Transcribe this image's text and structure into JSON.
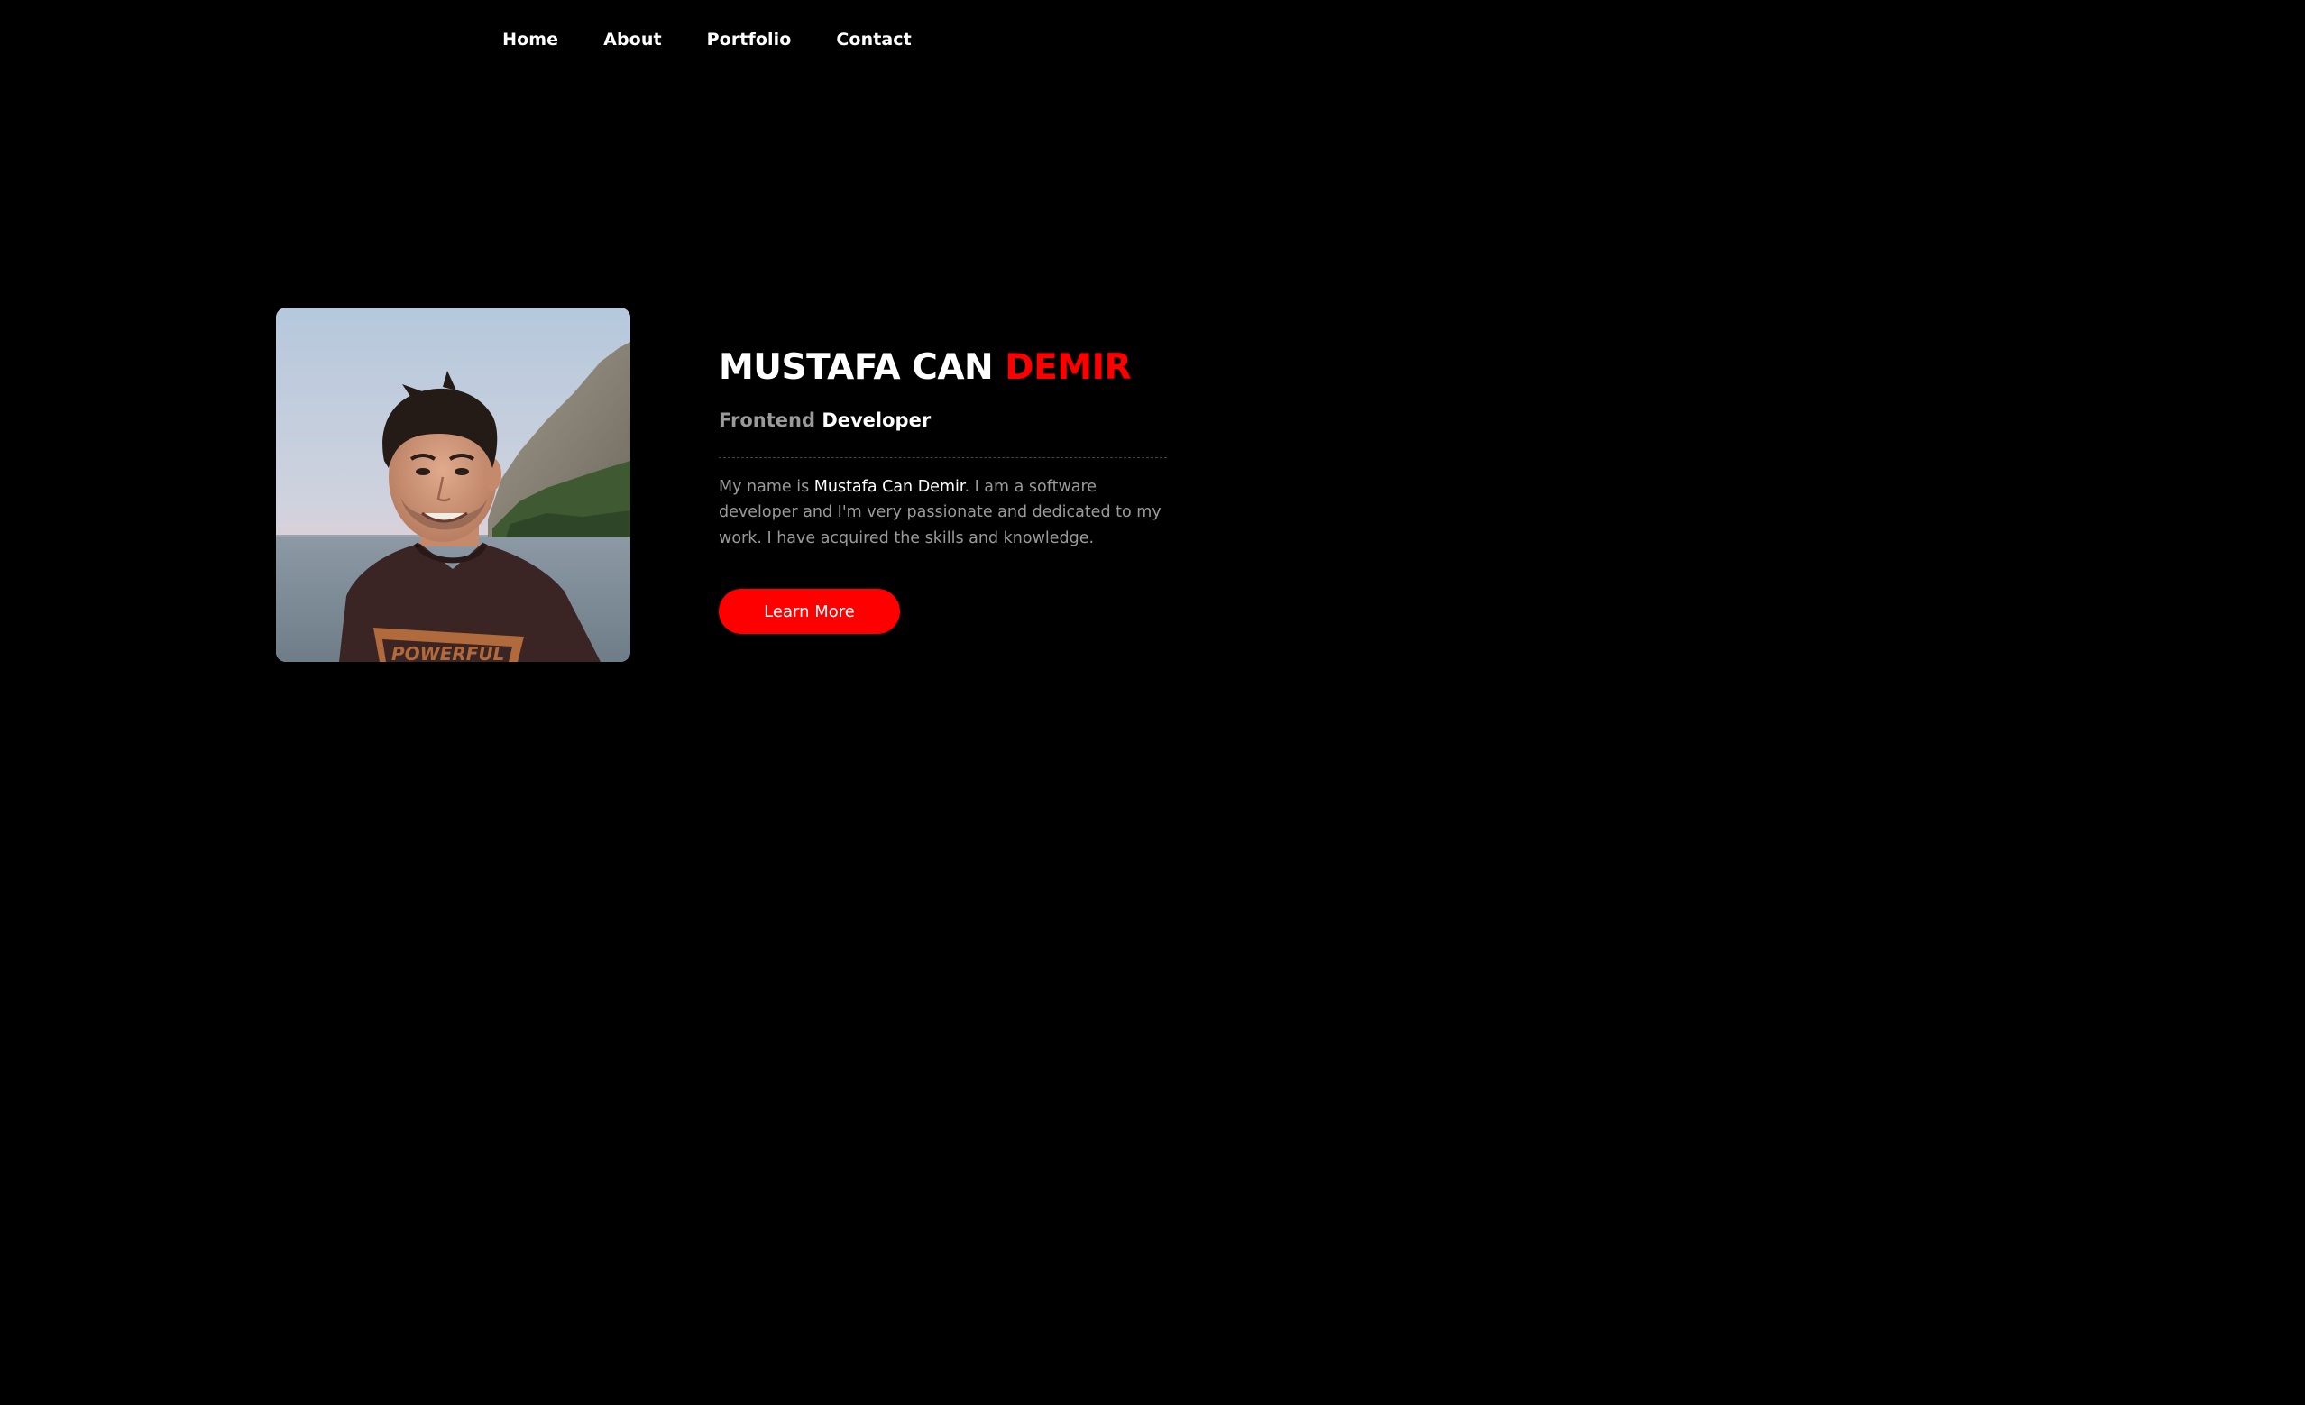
{
  "nav": {
    "items": [
      {
        "label": "Home"
      },
      {
        "label": "About"
      },
      {
        "label": "Portfolio"
      },
      {
        "label": "Contact"
      }
    ]
  },
  "hero": {
    "name_first": "MUSTAFA CAN",
    "name_last": "DEMIR",
    "role_muted": "Frontend",
    "role_strong": "Developer",
    "bio": {
      "prefix": "My name is ",
      "highlight": "Mustafa Can Demir",
      "suffix": ". I am a software developer and I'm very passionate and dedicated to my work. I have acquired the skills and knowledge."
    },
    "cta_label": "Learn More",
    "shirt_text": "POWERFUL"
  },
  "colors": {
    "background": "#000000",
    "accent": "#ff0000",
    "text": "#ffffff",
    "muted": "#9a9a9a"
  }
}
